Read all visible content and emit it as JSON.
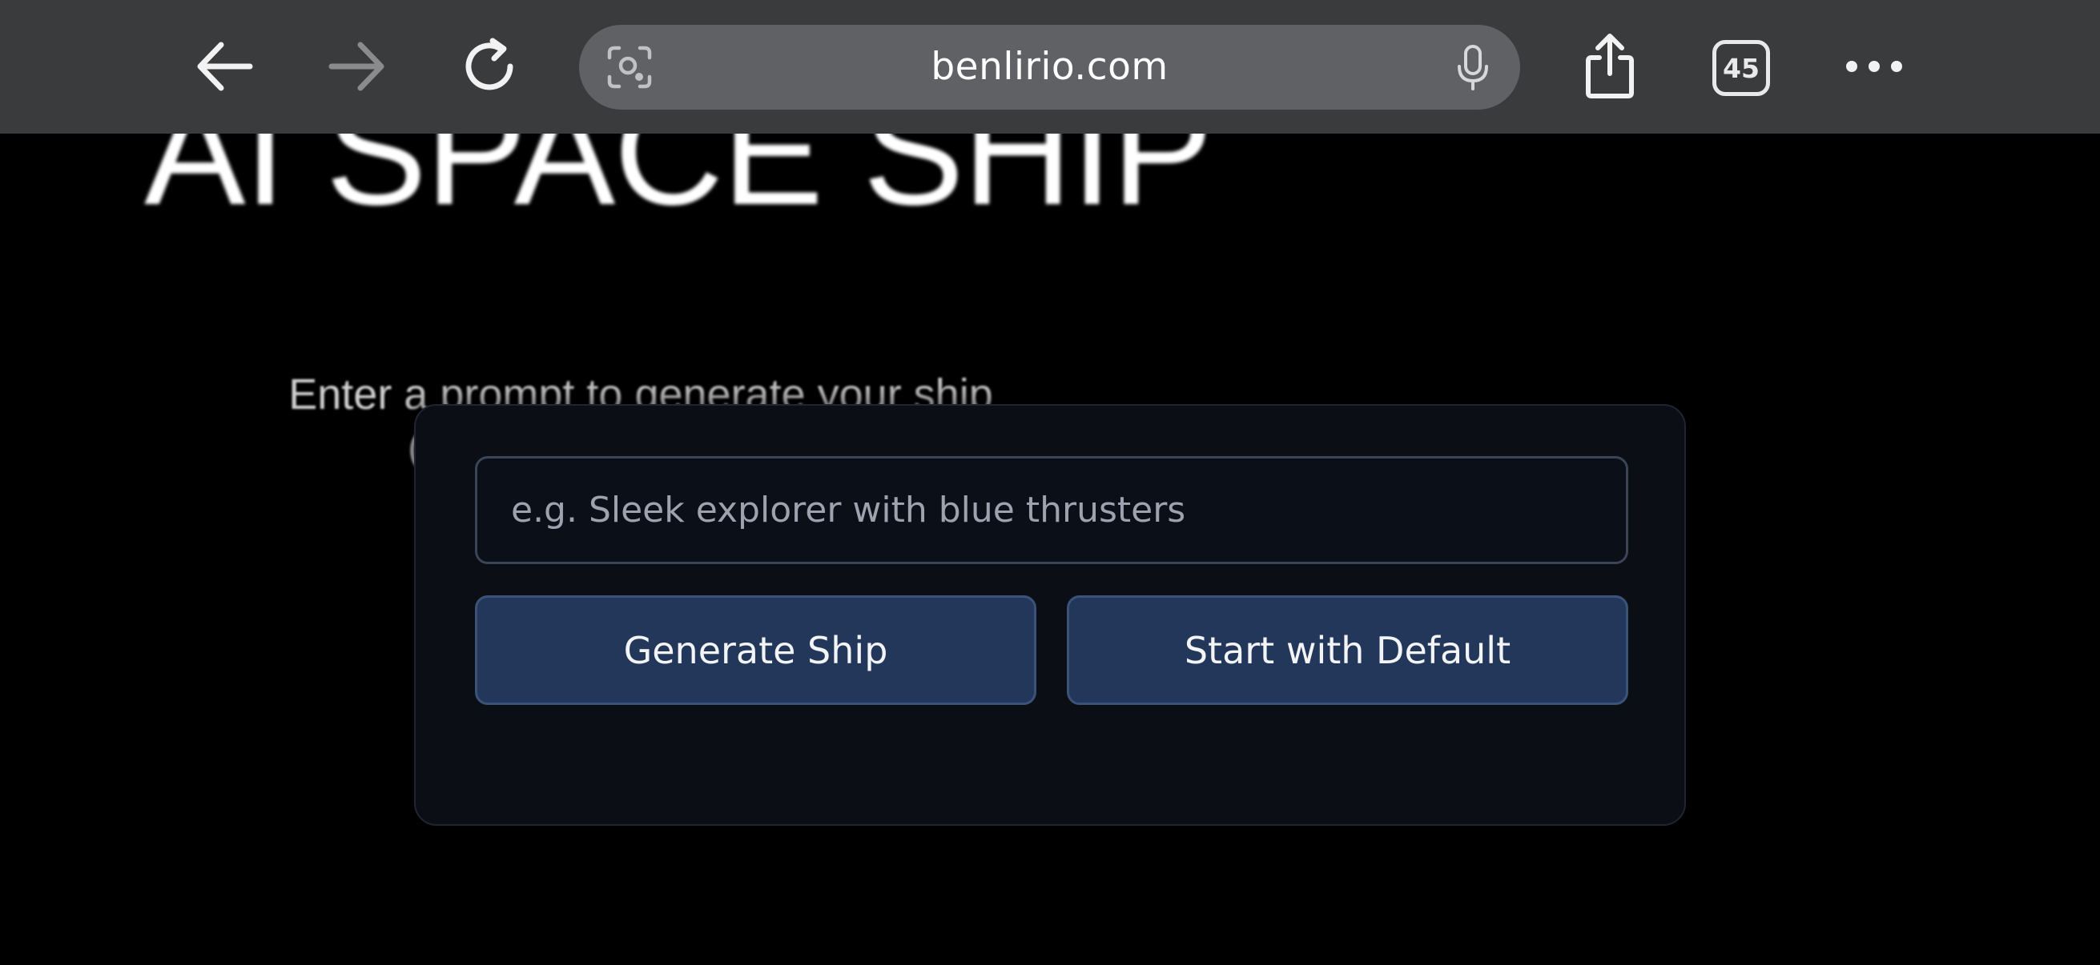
{
  "browser": {
    "url": "benlirio.com",
    "tab_count": "45",
    "icons": {
      "back": "arrow-left-icon",
      "forward": "arrow-right-icon",
      "reload": "reload-icon",
      "lens": "camera-search-icon",
      "mic": "microphone-icon",
      "share": "share-icon",
      "tabs": "tabs-icon",
      "more": "more-dots-icon"
    }
  },
  "page": {
    "title": "AI SPACE SHIP",
    "intro_line1": "Enter a prompt to generate your ship",
    "intro_line2": "(or start with the default)"
  },
  "modal": {
    "prompt_placeholder": "e.g. Sleek explorer with blue thrusters",
    "prompt_value": "",
    "generate_label": "Generate Ship",
    "default_label": "Start with Default"
  },
  "colors": {
    "toolbar_bg": "#3a3b3d",
    "url_pill_bg": "#5f6165",
    "page_bg": "#000000",
    "modal_bg": "#0b0e14",
    "button_bg": "#22375a",
    "button_border": "#3b5379"
  }
}
